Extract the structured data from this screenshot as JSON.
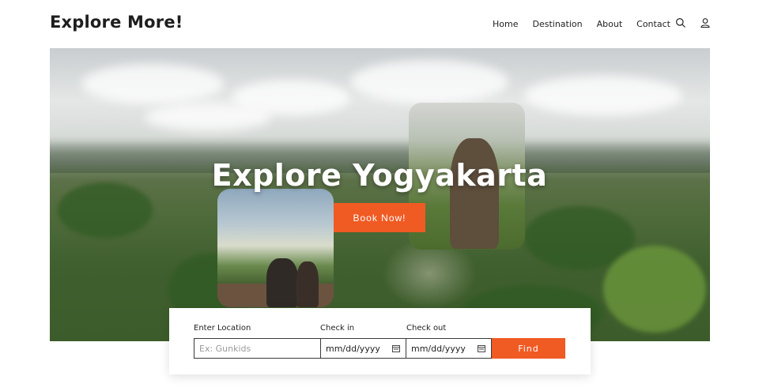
{
  "brand": "Explore More!",
  "nav": [
    "Home",
    "Destination",
    "About",
    "Contact"
  ],
  "icons": {
    "search": "search-icon",
    "user": "user-icon",
    "calendar": "calendar-icon"
  },
  "hero": {
    "title": "Explore Yogyakarta",
    "cta": "Book Now!"
  },
  "search": {
    "location_label": "Enter Location",
    "location_placeholder": "Ex: Gunkids",
    "checkin_label": "Check in",
    "checkin_value": "mm/dd/yyyy",
    "checkout_label": "Check out",
    "checkout_value": "mm/dd/yyyy",
    "find_label": "Find"
  },
  "colors": {
    "accent": "#f05a23",
    "text": "#1e1e1e"
  }
}
